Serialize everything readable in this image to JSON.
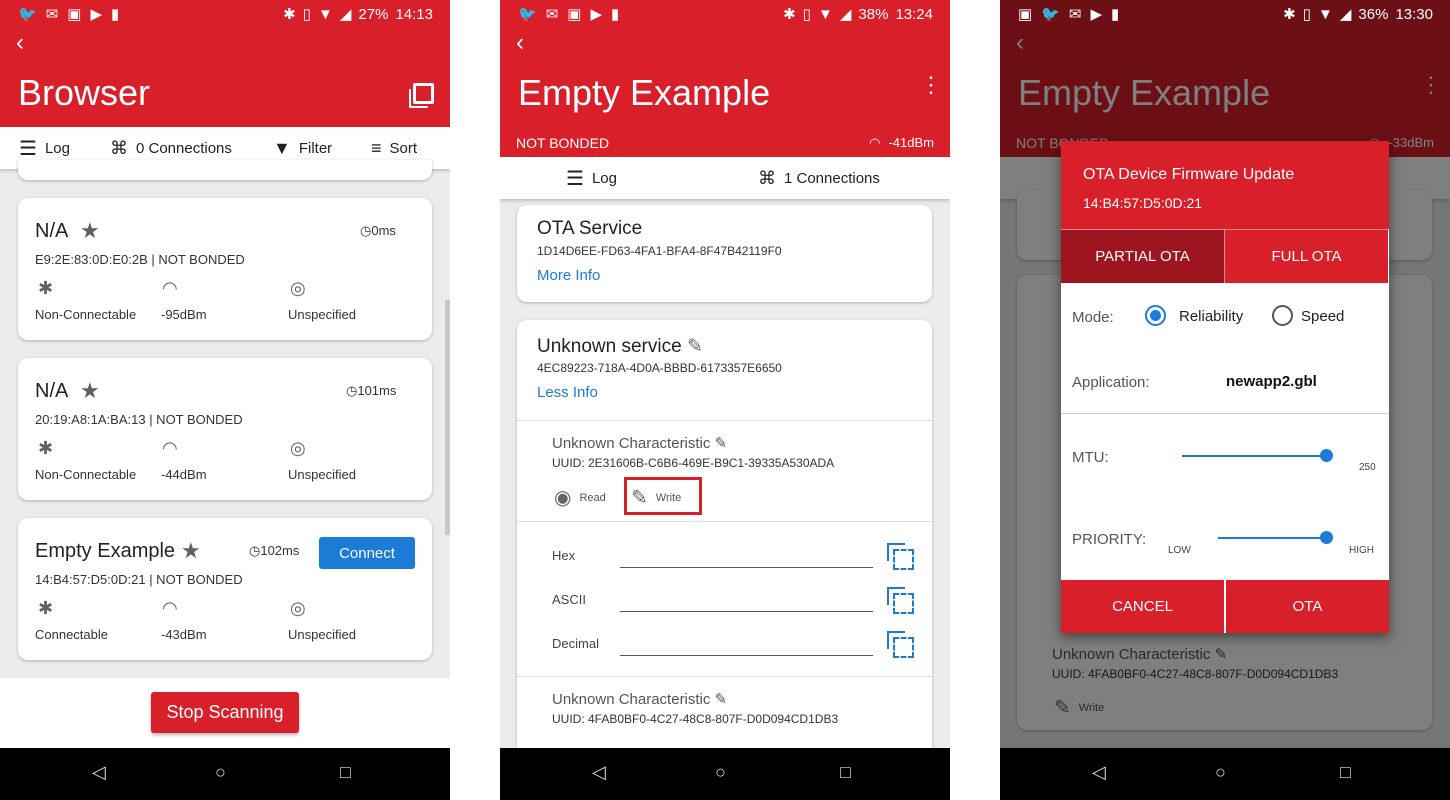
{
  "colors": {
    "primary": "#d81f2a",
    "accent": "#1c7bd6",
    "background": "#ececec"
  },
  "screen1": {
    "status": {
      "battery": "27%",
      "time": "14:13"
    },
    "title": "Browser",
    "toolbar": {
      "log": "Log",
      "connections": "0 Connections",
      "filter": "Filter",
      "sort": "Sort"
    },
    "devices": [
      {
        "name": "N/A",
        "time": "0ms",
        "mac": "E9:2E:83:0D:E0:2B | NOT BONDED",
        "connectable": "Non-Connectable",
        "rssi": "-95dBm",
        "type": "Unspecified"
      },
      {
        "name": "N/A",
        "time": "101ms",
        "mac": "20:19:A8:1A:BA:13 | NOT BONDED",
        "connectable": "Non-Connectable",
        "rssi": "-44dBm",
        "type": "Unspecified"
      },
      {
        "name": "Empty Example",
        "time": "102ms",
        "mac": "14:B4:57:D5:0D:21 | NOT BONDED",
        "connectable": "Connectable",
        "rssi": "-43dBm",
        "type": "Unspecified",
        "button": "Connect"
      }
    ],
    "stop_button": "Stop Scanning"
  },
  "screen2": {
    "status": {
      "battery": "38%",
      "time": "13:24"
    },
    "title": "Empty Example",
    "bond": "NOT BONDED",
    "rssi": "-41dBm",
    "toolbar": {
      "log": "Log",
      "connections": "1 Connections"
    },
    "ota_service": {
      "title": "OTA Service",
      "uuid": "1D14D6EE-FD63-4FA1-BFA4-8F47B42119F0",
      "link": "More Info"
    },
    "unknown_service": {
      "title": "Unknown service",
      "uuid": "4EC89223-718A-4D0A-BBBD-6173357E6650",
      "link": "Less Info"
    },
    "char1": {
      "title": "Unknown Characteristic",
      "uuid": "UUID: 2E31606B-C6B6-469E-B9C1-39335A530ADA",
      "read": "Read",
      "write": "Write"
    },
    "fields": [
      "Hex",
      "ASCII",
      "Decimal"
    ],
    "char2": {
      "title": "Unknown Characteristic",
      "uuid": "UUID: 4FAB0BF0-4C27-48C8-807F-D0D094CD1DB3"
    }
  },
  "screen3": {
    "status": {
      "battery": "36%",
      "time": "13:30"
    },
    "title": "Empty Example",
    "bond": "NOT BONDED",
    "rssi": "-33dBm",
    "bg_char": {
      "title": "Unknown Characteristic",
      "uuid": "UUID: 4FAB0BF0-4C27-48C8-807F-D0D094CD1DB3",
      "write": "Write"
    },
    "dialog": {
      "title": "OTA Device Firmware Update",
      "mac": "14:B4:57:D5:0D:21",
      "tab_partial": "PARTIAL OTA",
      "tab_full": "FULL OTA",
      "mode_label": "Mode:",
      "mode_reliability": "Reliability",
      "mode_speed": "Speed",
      "mode_selected": "Reliability",
      "application_label": "Application:",
      "application_value": "newapp2.gbl",
      "mtu_label": "MTU:",
      "mtu_value": "250",
      "priority_label": "PRIORITY:",
      "priority_low": "LOW",
      "priority_high": "HIGH",
      "cancel": "CANCEL",
      "ota": "OTA"
    }
  }
}
